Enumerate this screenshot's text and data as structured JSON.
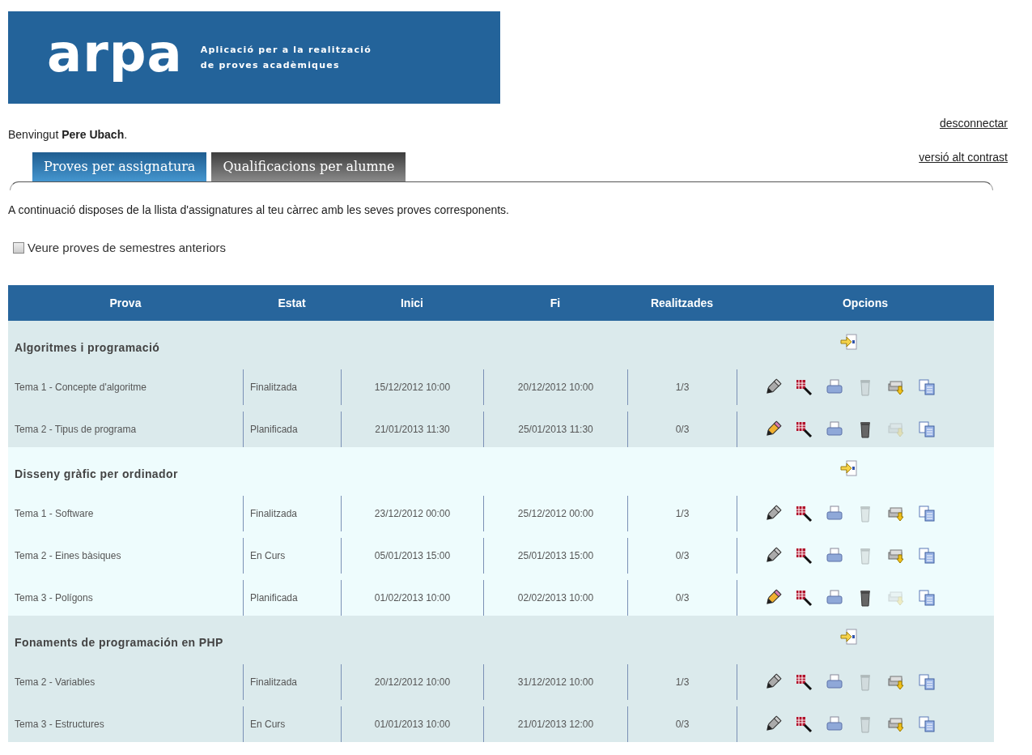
{
  "banner": {
    "logo": "arpa",
    "tagline_lines": [
      "Aplicació per a la realització",
      "de proves acadèmiques"
    ]
  },
  "welcome": {
    "prefix": "Benvingut ",
    "name": "Pere Ubach",
    "suffix": "."
  },
  "links": [
    "desconnectar",
    "versió alt contrast"
  ],
  "tabs": [
    {
      "label": "Proves per assignatura",
      "selected": true
    },
    {
      "label": "Qualificacions per alumne",
      "selected": false
    }
  ],
  "intro": "A continuació disposes de la llista d'assignatures al teu càrrec amb les seves proves corresponents.",
  "filter": {
    "label": "Veure proves de semestres anteriors",
    "checked": false
  },
  "table": {
    "columns": [
      "Prova",
      "Estat",
      "Inici",
      "Fi",
      "Realitzades",
      "Opcions"
    ],
    "groups": [
      {
        "name": "Algoritmes i programació",
        "rows": [
          {
            "prova": "Tema 1 - Concepte d'algoritme",
            "estat": "Finalitzada",
            "inici": "15/12/2012 10:00",
            "fi": "20/12/2012 10:00",
            "realitzades": "1/3",
            "editable": false
          },
          {
            "prova": "Tema 2 - Tipus de programa",
            "estat": "Planificada",
            "inici": "21/01/2013 11:30",
            "fi": "25/01/2013 11:30",
            "realitzades": "0/3",
            "editable": true
          }
        ]
      },
      {
        "name": "Disseny gràfic per ordinador",
        "rows": [
          {
            "prova": "Tema 1 - Software",
            "estat": "Finalitzada",
            "inici": "23/12/2012 00:00",
            "fi": "25/12/2012 00:00",
            "realitzades": "1/3",
            "editable": false
          },
          {
            "prova": "Tema 2 - Eines bàsiques",
            "estat": "En Curs",
            "inici": "05/01/2013 15:00",
            "fi": "25/01/2013 15:00",
            "realitzades": "0/3",
            "editable": false
          },
          {
            "prova": "Tema 3 - Polígons",
            "estat": "Planificada",
            "inici": "01/02/2013 10:00",
            "fi": "02/02/2013 10:00",
            "realitzades": "0/3",
            "editable": true
          }
        ]
      },
      {
        "name": "Fonaments de programación en PHP",
        "rows": [
          {
            "prova": "Tema 2 - Variables",
            "estat": "Finalitzada",
            "inici": "20/12/2012 10:00",
            "fi": "31/12/2012 10:00",
            "realitzades": "1/3",
            "editable": false
          },
          {
            "prova": "Tema 3 - Estructures",
            "estat": "En Curs",
            "inici": "01/01/2013 10:00",
            "fi": "21/01/2013 12:00",
            "realitzades": "0/3",
            "editable": false
          }
        ]
      }
    ]
  }
}
